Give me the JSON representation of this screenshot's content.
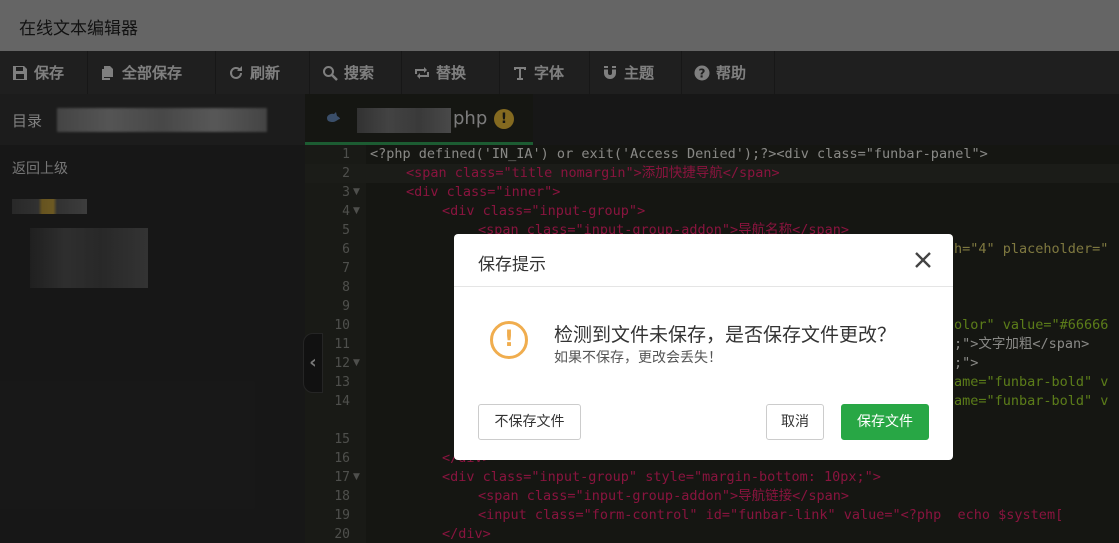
{
  "app": {
    "title": "在线文本编辑器"
  },
  "toolbar": {
    "items": [
      {
        "icon": "save-icon",
        "label": "保存"
      },
      {
        "icon": "copy-icon",
        "label": "全部保存"
      },
      {
        "icon": "refresh-icon",
        "label": "刷新"
      },
      {
        "icon": "search-icon",
        "label": "搜索"
      },
      {
        "icon": "replace-icon",
        "label": "替换"
      },
      {
        "icon": "text-icon",
        "label": "字体"
      },
      {
        "icon": "magnet-icon",
        "label": "主题"
      },
      {
        "icon": "question-icon",
        "label": "帮助"
      }
    ]
  },
  "sidebar": {
    "header_label": "目录",
    "back_label": "返回上级"
  },
  "tab": {
    "name_suffix": "php",
    "warn_glyph": "!"
  },
  "editor": {
    "line_numbers": [
      "1",
      "2",
      "3",
      "4",
      "5",
      "6",
      "7",
      "8",
      "9",
      "10",
      "11",
      "12",
      "13",
      "14",
      "15",
      "16",
      "17",
      "18",
      "19",
      "20"
    ],
    "visible_code": [
      "<?php defined('IN_IA') or exit('Access Denied');?><div class=\"funbar-panel\">",
      "<span class=\"title nomargin\">添加快捷导航</span>",
      "<div class=\"inner\">",
      "<div class=\"input-group\">",
      "<span class=\"input-group-addon\">导航名称</span>",
      "h=\"4\" placeholder=\"",
      "olor\" value=\"#66666",
      ";\">文字加粗</span>",
      ";\">",
      "ame=\"funbar-bold\" v",
      "ame=\"funbar-bold\" v",
      "</div>",
      "<div class=\"input-group\" style=\"margin-bottom: 10px;\">",
      "<span class=\"input-group-addon\">导航链接</span>",
      "<input class=\"form-control\" id=\"funbar-link\" value=\"<?php  echo $system[",
      "</div>"
    ]
  },
  "modal": {
    "title": "保存提示",
    "message": "检测到文件未保存，是否保存文件更改？",
    "sub_message": "如果不保存，更改会丢失！",
    "buttons": {
      "no_save": "不保存文件",
      "cancel": "取消",
      "save": "保存文件"
    }
  },
  "colors": {
    "accent_green": "#28a745",
    "warning": "#f0ad4e",
    "editor_bg": "#272822"
  }
}
